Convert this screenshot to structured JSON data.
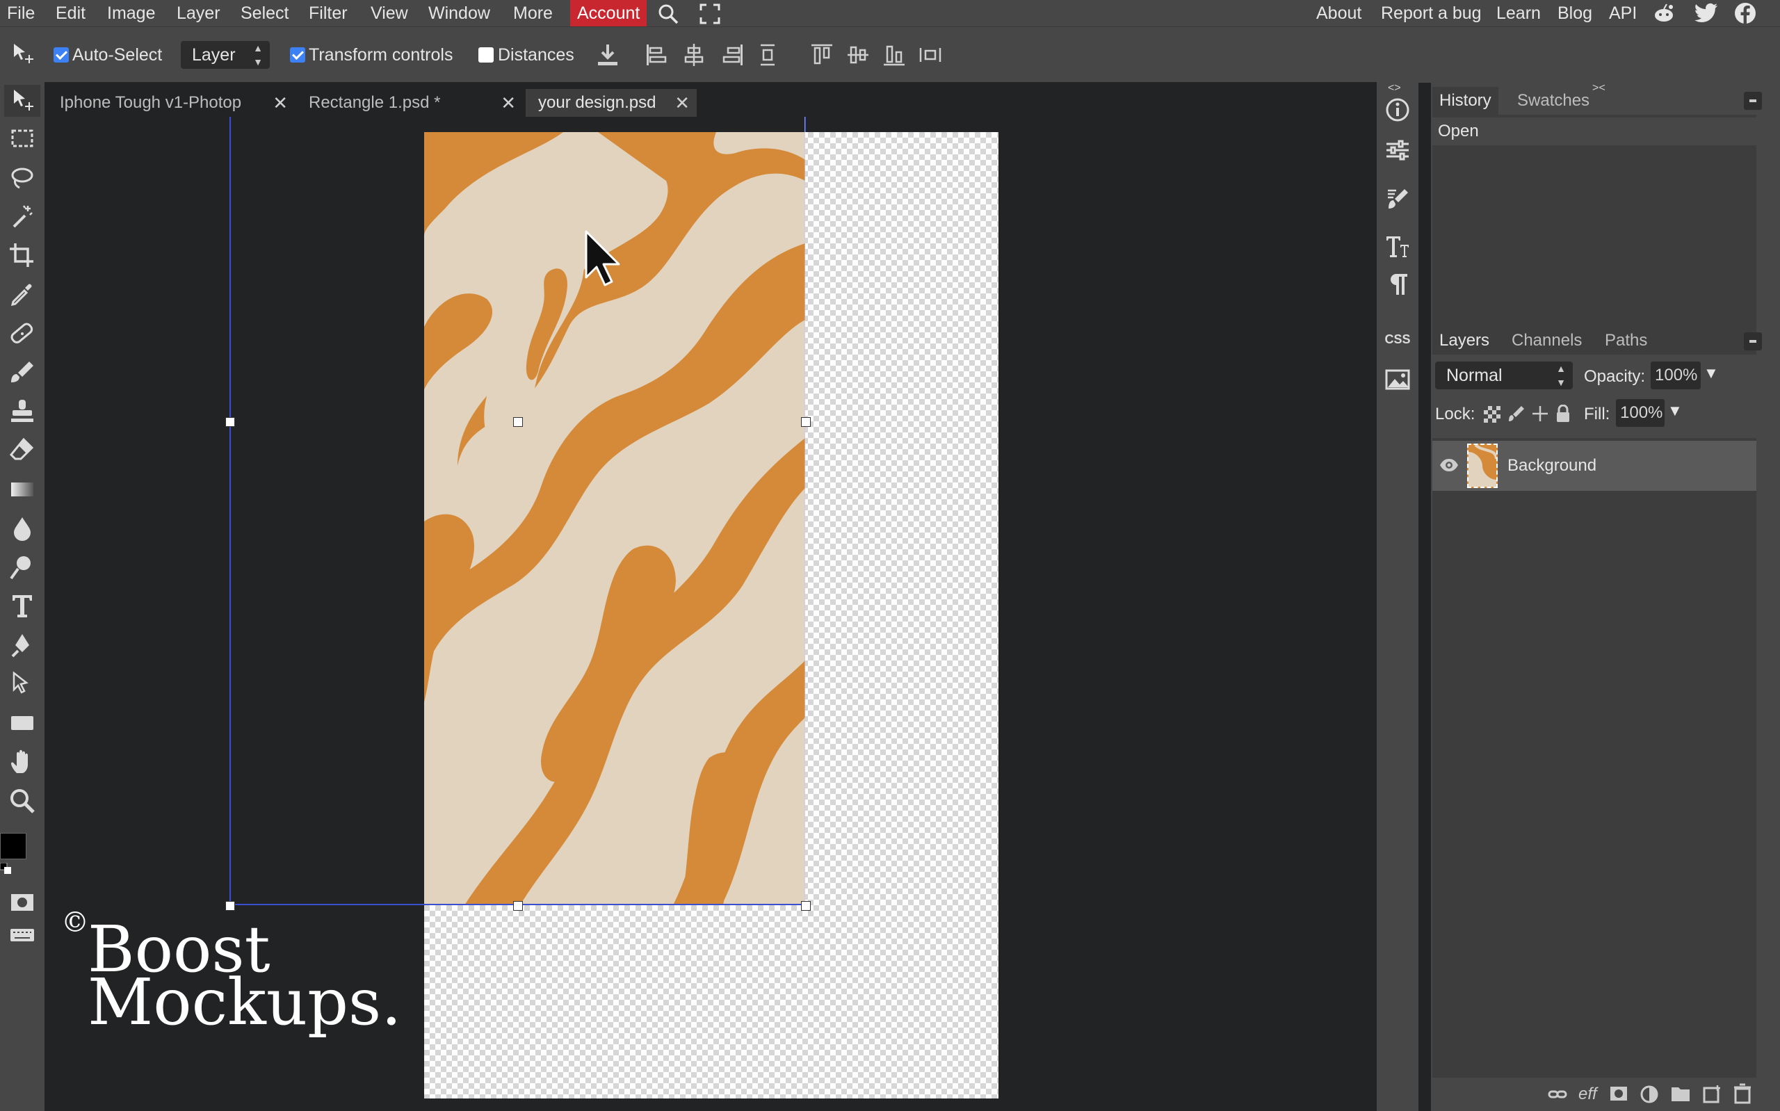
{
  "menubar": {
    "items": [
      "File",
      "Edit",
      "Image",
      "Layer",
      "Select",
      "Filter",
      "View",
      "Window",
      "More",
      "Account"
    ],
    "right_items": [
      "About",
      "Report a bug",
      "Learn",
      "Blog",
      "API"
    ],
    "accent_color": "#c8272f"
  },
  "options": {
    "auto_select_label": "Auto-Select",
    "auto_select_checked": true,
    "layer_select_value": "Layer",
    "transform_controls_label": "Transform controls",
    "transform_controls_checked": true,
    "distances_label": "Distances",
    "distances_checked": false
  },
  "tabs": [
    {
      "label": "Iphone Tough v1-Photop",
      "active": false
    },
    {
      "label": "Rectangle 1.psd *",
      "active": false
    },
    {
      "label": "your design.psd",
      "active": true
    }
  ],
  "history_panel": {
    "tabs": [
      "History",
      "Swatches"
    ],
    "items": [
      "Open"
    ]
  },
  "layers_panel": {
    "tabs": [
      "Layers",
      "Channels",
      "Paths"
    ],
    "blend_mode": "Normal",
    "opacity_label": "Opacity:",
    "opacity_value": "100%",
    "lock_label": "Lock:",
    "fill_label": "Fill:",
    "fill_value": "100%",
    "layers": [
      {
        "name": "Background",
        "visible": true
      }
    ]
  },
  "rightcol": {
    "css_label": "CSS"
  },
  "bottom_icons": [
    "link-icon",
    "effects-icon",
    "mask-icon",
    "adjustment-icon",
    "folder-icon",
    "new-layer-icon",
    "delete-icon"
  ],
  "bottom_eff_label": "eff",
  "watermark": {
    "symbol": "©",
    "line1": "Boost",
    "line2": "Mockups."
  },
  "colors": {
    "artwork_orange": "#d58a3a",
    "artwork_cream": "#e2d3bf",
    "ui_dark": "#222324",
    "ui_panel": "#474747"
  }
}
